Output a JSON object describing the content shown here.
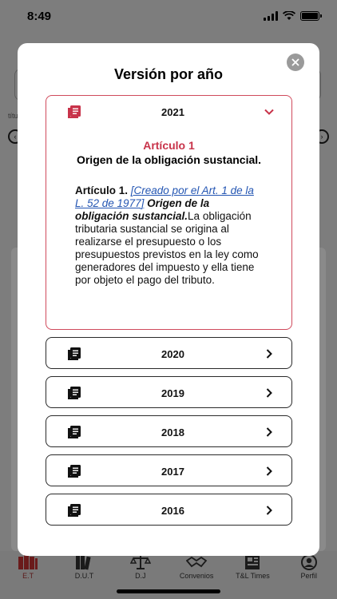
{
  "status_bar": {
    "time": "8:49"
  },
  "background": {
    "label_partial": "títu",
    "left_circle_icon": "chevron-left-circle-icon",
    "right_circle_icon": "chevron-right-circle-icon"
  },
  "modal": {
    "title": "Versión por año",
    "close_icon": "close-icon",
    "expanded": {
      "year": "2021",
      "article_title": "Artículo 1",
      "article_subtitle": "Origen de la obligación sustancial.",
      "text_lead": "Artículo 1.",
      "text_link": "[Creado por el Art. 1 de la L. 52 de 1977]",
      "text_bold_italic": "Origen de la obligación sustancial.",
      "text_body": "La obligación tributaria sustancial se origina al realizarse el presupuesto o los presupuestos previstos en la ley como generadores del impuesto y ella tiene por objeto el pago del tributo."
    },
    "years": [
      "2020",
      "2019",
      "2018",
      "2017",
      "2016"
    ]
  },
  "tab_bar": {
    "items": [
      {
        "label": "E.T",
        "icon": "books-icon",
        "active": true
      },
      {
        "label": "D.U.T",
        "icon": "book-stack-icon",
        "active": false
      },
      {
        "label": "D.J",
        "icon": "scales-icon",
        "active": false
      },
      {
        "label": "Convenios",
        "icon": "handshake-icon",
        "active": false
      },
      {
        "label": "T&L Times",
        "icon": "newspaper-icon",
        "active": false
      },
      {
        "label": "Perfil",
        "icon": "user-icon",
        "active": false
      }
    ]
  },
  "colors": {
    "accent": "#c8334a",
    "overlay": "#7d7d7d",
    "link": "#2456b3"
  }
}
